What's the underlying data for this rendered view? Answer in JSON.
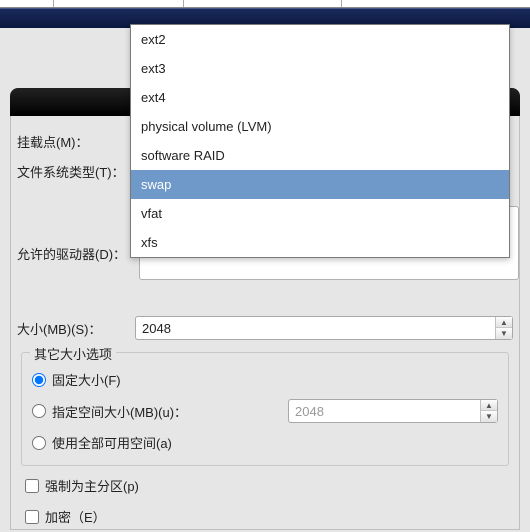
{
  "fs_options": [
    "ext2",
    "ext3",
    "ext4",
    "physical volume (LVM)",
    "software RAID",
    "swap",
    "vfat",
    "xfs"
  ],
  "fs_selected_index": 5,
  "labels": {
    "mountpoint": "挂载点(M)：",
    "fstype": "文件系统类型(T)：",
    "allowed_drives": "允许的驱动器(D)：",
    "size": "大小(MB)(S)：",
    "size_options": "其它大小选项",
    "fixed_size": "固定大小(F)",
    "fill_to": "指定空间大小(MB)(u)：",
    "fill_all": "使用全部可用空间(a)",
    "primary": "强制为主分区(p)",
    "encrypt": "加密（E）"
  },
  "size_value": "2048",
  "fill_to_value": "2048",
  "radios": {
    "fixed": true,
    "fill_to": false,
    "fill_all": false
  },
  "checks": {
    "primary": false,
    "encrypt": false
  }
}
